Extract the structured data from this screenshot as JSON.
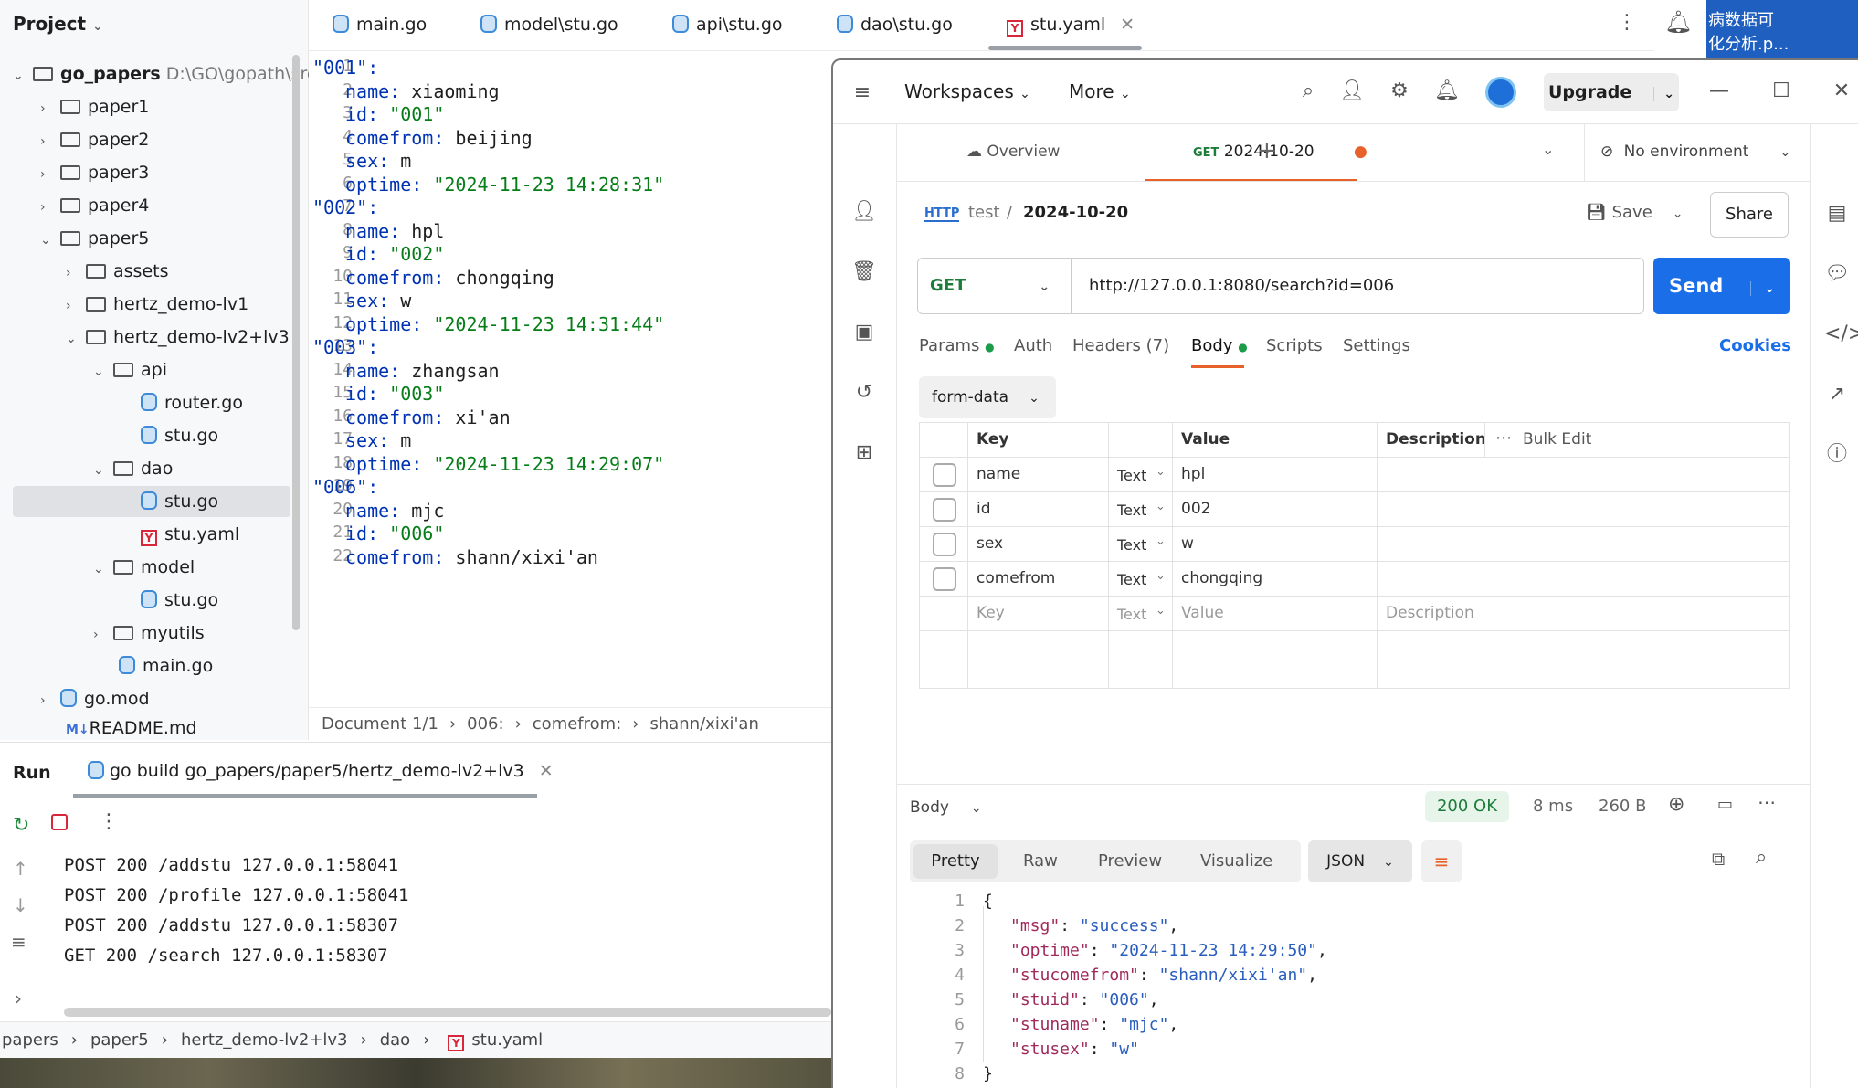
{
  "project": {
    "title": "Project",
    "root": "go_papers",
    "root_path": "D:\\GO\\gopath\\src\\",
    "items": [
      "paper1",
      "paper2",
      "paper3",
      "paper4",
      "paper5",
      "assets",
      "hertz_demo-lv1",
      "hertz_demo-lv2+lv3",
      "api",
      "router.go",
      "stu.go",
      "dao",
      "stu.go",
      "stu.yaml",
      "model",
      "stu.go",
      "myutils",
      "main.go",
      "go.mod",
      "README.md"
    ]
  },
  "tabs": [
    "main.go",
    "model\\stu.go",
    "api\\stu.go",
    "dao\\stu.go",
    "stu.yaml"
  ],
  "editor": {
    "line_numbers": [
      "1",
      "2",
      "3",
      "4",
      "5",
      "6",
      "7",
      "8",
      "9",
      "10",
      "11",
      "12",
      "13",
      "14",
      "15",
      "16",
      "17",
      "18",
      "19",
      "20",
      "21",
      "22"
    ],
    "lines": [
      [
        "\"001\":",
        ""
      ],
      [
        "name:",
        " xiaoming"
      ],
      [
        "id:",
        " \"001\""
      ],
      [
        "comefrom:",
        " beijing"
      ],
      [
        "sex:",
        " m"
      ],
      [
        "optime:",
        " \"2024-11-23 14:28:31\""
      ],
      [
        "\"002\":",
        ""
      ],
      [
        "name:",
        " hpl"
      ],
      [
        "id:",
        " \"002\""
      ],
      [
        "comefrom:",
        " chongqing"
      ],
      [
        "sex:",
        " w"
      ],
      [
        "optime:",
        " \"2024-11-23 14:31:44\""
      ],
      [
        "\"003\":",
        ""
      ],
      [
        "name:",
        " zhangsan"
      ],
      [
        "id:",
        " \"003\""
      ],
      [
        "comefrom:",
        " xi'an"
      ],
      [
        "sex:",
        " m"
      ],
      [
        "optime:",
        " \"2024-11-23 14:29:07\""
      ],
      [
        "\"006\":",
        ""
      ],
      [
        "name:",
        " mjc"
      ],
      [
        "id:",
        " \"006\""
      ],
      [
        "comefrom:",
        " shann/xixi'an"
      ]
    ],
    "breadcrumb": [
      "Document 1/1",
      "006:",
      "comefrom:",
      "shann/xixi'an"
    ]
  },
  "run": {
    "title": "Run",
    "config": "go build go_papers/paper5/hertz_demo-lv2+lv3",
    "output": [
      "POST 200 /addstu 127.0.0.1:58041",
      "POST 200 /profile 127.0.0.1:58041",
      "POST 200 /addstu 127.0.0.1:58307",
      "GET 200 /search 127.0.0.1:58307"
    ]
  },
  "statusbar": [
    "papers",
    "paper5",
    "hertz_demo-lv2+lv3",
    "dao",
    "stu.yaml"
  ],
  "banner": [
    "病数据可",
    "化分析.p..."
  ],
  "postman": {
    "workspaces": "Workspaces",
    "more": "More",
    "upgrade": "Upgrade",
    "overview_tab": "Overview",
    "req_tab_method": "GET",
    "req_tab_name": "2024-10-20",
    "no_env": "No environment",
    "crumb_collection": "test",
    "crumb_request": "2024-10-20",
    "save": "Save",
    "share": "Share",
    "method": "GET",
    "url": "http://127.0.0.1:8080/search?id=006",
    "send": "Send",
    "req_tabs": [
      "Params",
      "Auth",
      "Headers (7)",
      "Body",
      "Scripts",
      "Settings"
    ],
    "cookies": "Cookies",
    "body_mode": "form-data",
    "table_headers": [
      "Key",
      "Value",
      "Description",
      "Bulk Edit"
    ],
    "rows": [
      {
        "key": "name",
        "type": "Text",
        "value": "hpl"
      },
      {
        "key": "id",
        "type": "Text",
        "value": "002"
      },
      {
        "key": "sex",
        "type": "Text",
        "value": "w"
      },
      {
        "key": "comefrom",
        "type": "Text",
        "value": "chongqing"
      }
    ],
    "placeholder_row": {
      "key": "Key",
      "type": "Text",
      "value": "Value",
      "desc": "Description"
    },
    "resp_label": "Body",
    "status": "200 OK",
    "time": "8 ms",
    "size": "260 B",
    "resp_tabs": [
      "Pretty",
      "Raw",
      "Preview",
      "Visualize"
    ],
    "format": "JSON",
    "resp_lines": [
      "1",
      "2",
      "3",
      "4",
      "5",
      "6",
      "7",
      "8"
    ],
    "resp_json": [
      [
        "{",
        ""
      ],
      [
        "\"msg\"",
        "\"success\""
      ],
      [
        "\"optime\"",
        "\"2024-11-23 14:29:50\""
      ],
      [
        "\"stucomefrom\"",
        "\"shann/xixi'an\""
      ],
      [
        "\"stuid\"",
        "\"006\""
      ],
      [
        "\"stuname\"",
        "\"mjc\""
      ],
      [
        "\"stusex\"",
        "\"w\""
      ],
      [
        "}",
        ""
      ]
    ]
  }
}
